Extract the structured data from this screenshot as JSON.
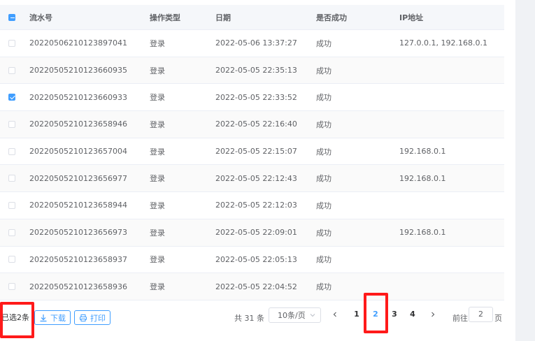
{
  "table": {
    "columns": [
      "流水号",
      "操作类型",
      "日期",
      "是否成功",
      "IP地址"
    ],
    "rows": [
      {
        "checked": false,
        "serial": "20220506210123897041",
        "type": "登录",
        "date": "2022-05-06 13:37:27",
        "success": "成功",
        "ip": "127.0.0.1, 192.168.0.1"
      },
      {
        "checked": false,
        "serial": "20220505210123660935",
        "type": "登录",
        "date": "2022-05-05 22:35:13",
        "success": "成功",
        "ip": ""
      },
      {
        "checked": true,
        "serial": "20220505210123660933",
        "type": "登录",
        "date": "2022-05-05 22:33:52",
        "success": "成功",
        "ip": ""
      },
      {
        "checked": false,
        "serial": "20220505210123658946",
        "type": "登录",
        "date": "2022-05-05 22:16:40",
        "success": "成功",
        "ip": ""
      },
      {
        "checked": false,
        "serial": "20220505210123657004",
        "type": "登录",
        "date": "2022-05-05 22:15:07",
        "success": "成功",
        "ip": "192.168.0.1"
      },
      {
        "checked": false,
        "serial": "20220505210123656977",
        "type": "登录",
        "date": "2022-05-05 22:12:43",
        "success": "成功",
        "ip": "192.168.0.1"
      },
      {
        "checked": false,
        "serial": "20220505210123658944",
        "type": "登录",
        "date": "2022-05-05 22:12:03",
        "success": "成功",
        "ip": ""
      },
      {
        "checked": false,
        "serial": "20220505210123656973",
        "type": "登录",
        "date": "2022-05-05 22:09:01",
        "success": "成功",
        "ip": "192.168.0.1"
      },
      {
        "checked": false,
        "serial": "20220505210123658937",
        "type": "登录",
        "date": "2022-05-05 22:05:13",
        "success": "成功",
        "ip": ""
      },
      {
        "checked": false,
        "serial": "20220505210123658936",
        "type": "登录",
        "date": "2022-05-05 22:04:52",
        "success": "成功",
        "ip": ""
      }
    ]
  },
  "footer": {
    "selected_text": "已选2条",
    "download_label": "下载",
    "print_label": "打印"
  },
  "pagination": {
    "total_text": "共 31 条",
    "page_size": "10条/页",
    "pages": [
      "1",
      "2",
      "3",
      "4"
    ],
    "current_page": "2",
    "goto_label": "前往",
    "goto_value": "2",
    "goto_suffix": "页"
  },
  "colors": {
    "accent": "#409eff",
    "highlight": "#ff1a1a"
  }
}
